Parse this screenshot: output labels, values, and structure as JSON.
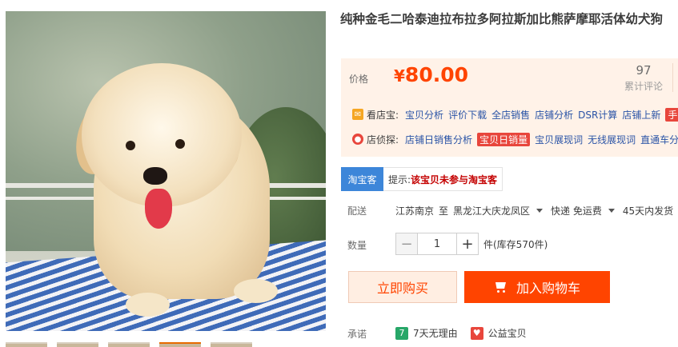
{
  "product": {
    "title": "纯种金毛二哈泰迪拉布拉多阿拉斯加比熊萨摩耶活体幼犬狗"
  },
  "price": {
    "label": "价格",
    "currency": "¥",
    "value": "80.00"
  },
  "reviews": {
    "count": "97",
    "label": "累计评论"
  },
  "tools": {
    "row1": {
      "icon": "kan-dian-bao-icon",
      "label": "看店宝:",
      "links": [
        "宝贝分析",
        "评价下载",
        "全店销售",
        "店铺分析",
        "DSR计算",
        "店铺上新"
      ],
      "highlight": "手淘"
    },
    "row2": {
      "icon": "dian-zhen-tan-icon",
      "label": "店侦探:",
      "links_before": [
        "店铺日销售分析"
      ],
      "highlight": "宝贝日销量",
      "links_after": [
        "宝贝展现词",
        "无线展现词",
        "直通车分析"
      ]
    }
  },
  "taobaoke": {
    "badge": "淘宝客",
    "tip_prefix": "提示:",
    "tip_text": "该宝贝未参与淘宝客"
  },
  "shipping": {
    "label": "配送",
    "from": "江苏南京",
    "to_word": "至",
    "destination": "黑龙江大庆龙凤区",
    "method": "快递 免运费",
    "delivery": "45天内发货"
  },
  "quantity": {
    "label": "数量",
    "minus": "−",
    "value": "1",
    "plus": "+",
    "stock": "件(库存570件)"
  },
  "actions": {
    "buy_now": "立即购买",
    "add_to_cart": "加入购物车"
  },
  "promise": {
    "label": "承诺",
    "items": [
      {
        "icon": "seven-day-return-icon",
        "glyph": "7",
        "text": "7天无理由"
      },
      {
        "icon": "charity-icon",
        "glyph": "♥",
        "text": "公益宝贝"
      }
    ]
  },
  "colors": {
    "accent": "#ff4400",
    "price_bg": "#fff2e8",
    "link": "#2953a6",
    "taobaoke_badge": "#3d86d9"
  }
}
